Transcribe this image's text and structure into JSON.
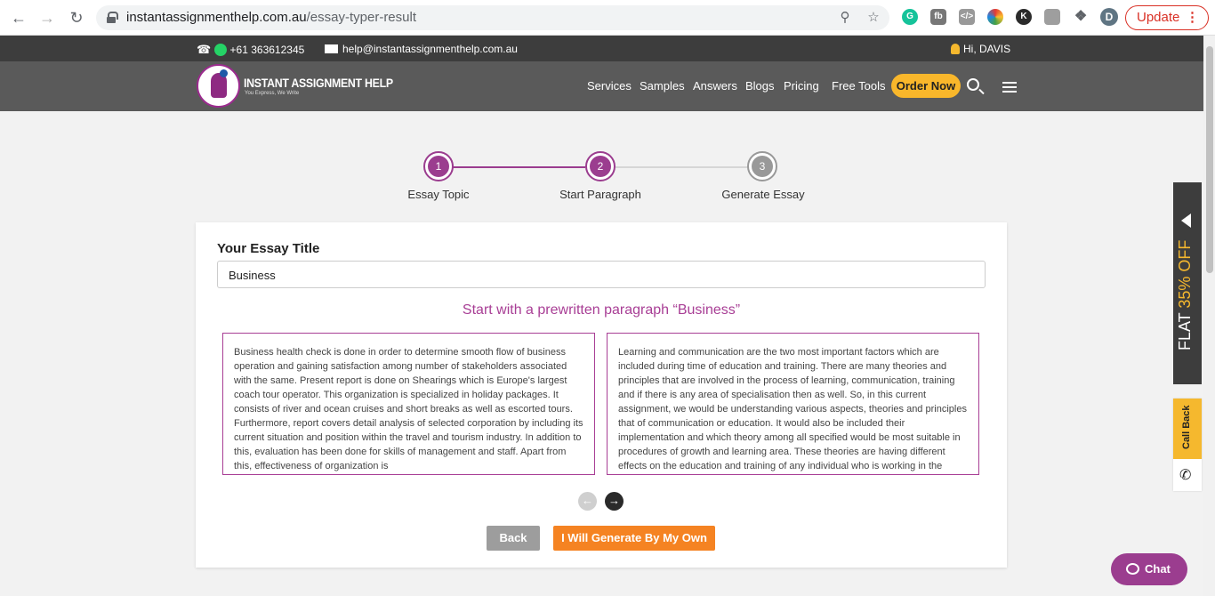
{
  "browser": {
    "url_host": "instantassignmenthelp.com.au",
    "url_path": "/essay-typer-result",
    "update_label": "Update",
    "profile_initial": "D"
  },
  "topbar": {
    "phone": "+61 363612345",
    "email": "help@instantassignmenthelp.com.au",
    "greeting": "Hi, DAVIS"
  },
  "header": {
    "logo_name": "INSTANT ASSIGNMENT HELP",
    "logo_tagline": "You Express, We Write",
    "menu": [
      "Services",
      "Samples",
      "Answers",
      "Blogs",
      "Pricing",
      "Free Tools"
    ],
    "order_label": "Order Now"
  },
  "stepper": {
    "steps": [
      {
        "number": "1",
        "label": "Essay Topic"
      },
      {
        "number": "2",
        "label": "Start Paragraph"
      },
      {
        "number": "3",
        "label": "Generate Essay"
      }
    ],
    "colors": {
      "active": "#9b3d8f",
      "inactive": "#999999"
    }
  },
  "card": {
    "title_label": "Your Essay Title",
    "title_value": "Business",
    "subheading": "Start with a prewritten paragraph “Business”",
    "paragraphs": [
      "Business health check is done in order to determine smooth flow of business operation and gaining satisfaction among number of stakeholders associated with the same. Present report is done on Shearings which is Europe's largest coach tour operator. This organization is specialized in holiday packages. It consists of river and ocean cruises and short breaks as well as escorted tours. Furthermore, report covers  detail analysis of selected corporation by including its current situation and position within the travel and tourism industry. In addition to this, evaluation has been done for skills of  management and staff. Apart from this, effectiveness of organization is",
      "Learning and communication are the two most important factors which are included during time of education and training. There are many theories and principles that are involved in the process of learning, communication, training and if there is any area of specialisation then as well. So, in this current assignment, we would be understanding various aspects, theories and principles that of communication or education. It would also be included their implementation and which theory among all specified would be most suitable in procedures of growth and learning area. These theories are having different effects on the education and training of any individual who is working in the"
    ],
    "back_label": "Back",
    "generate_label": "I Will Generate By My Own"
  },
  "side": {
    "promo_prefix": "FLAT ",
    "promo_highlight": "35% OFF",
    "callback_label": "Call Back"
  },
  "chat": {
    "label": "Chat"
  },
  "theme": {
    "purple": "#9b3d8f",
    "orange": "#f58322",
    "yellow": "#f5b82e"
  }
}
